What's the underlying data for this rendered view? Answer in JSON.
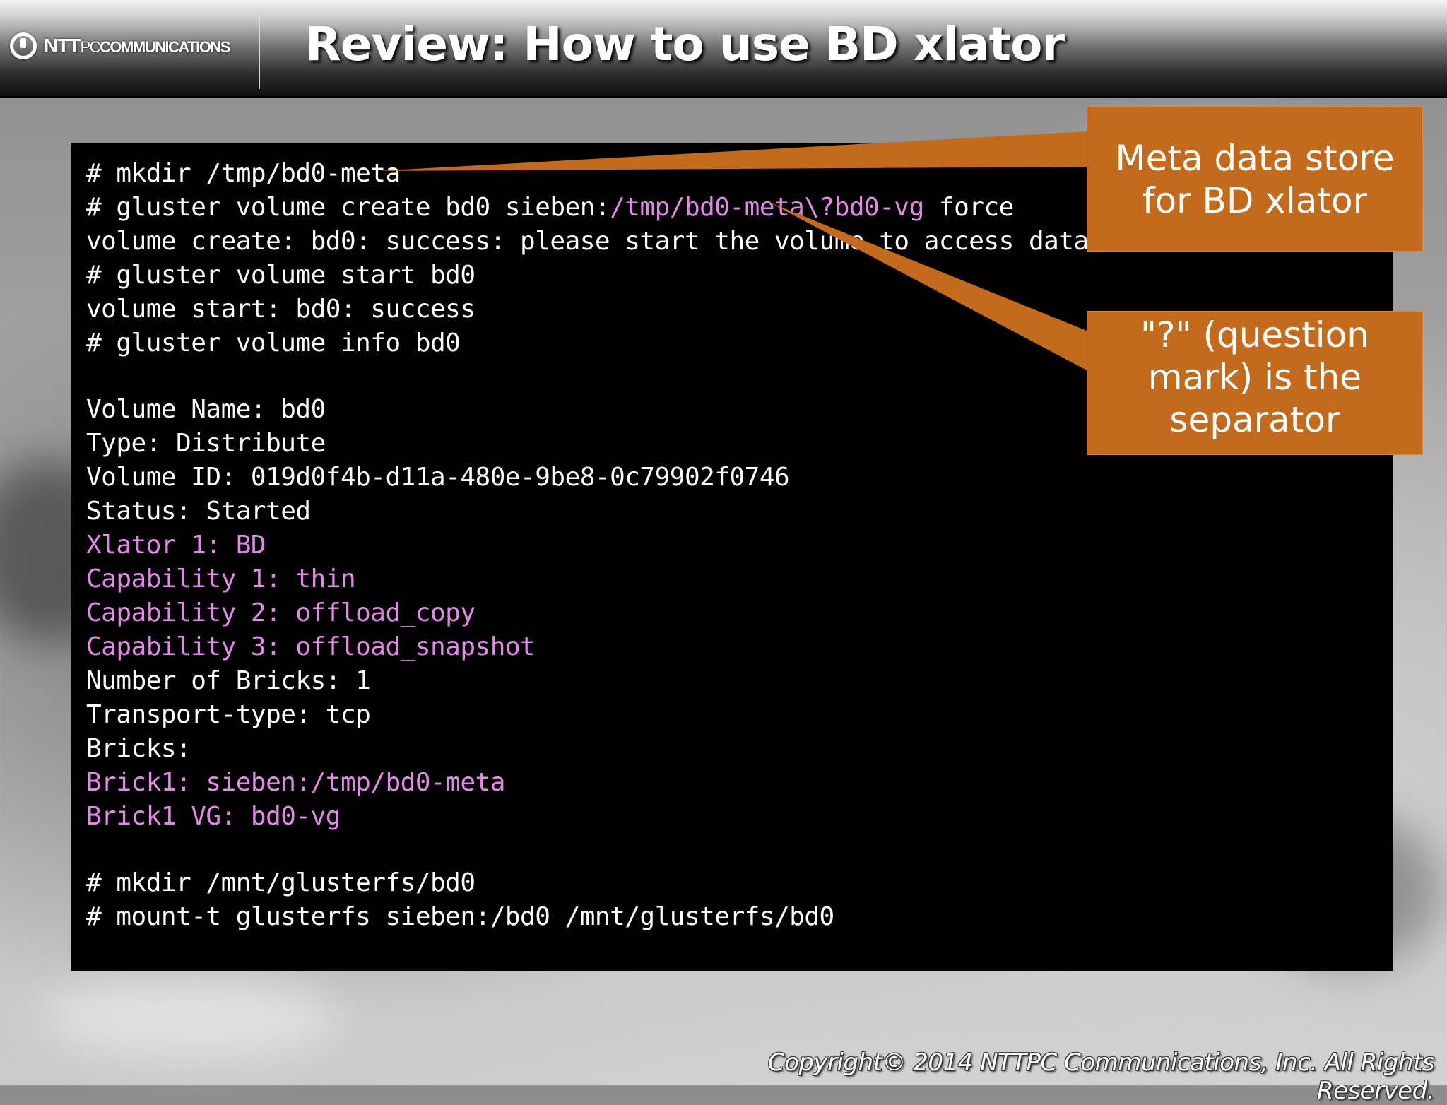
{
  "header": {
    "logo_main": "NTT",
    "logo_sub": "PC",
    "logo_tail": "COMMUNICATIONS",
    "title": "Review: How to use BD xlator"
  },
  "terminal": {
    "lines": [
      {
        "text": "# mkdir /tmp/bd0-meta"
      },
      {
        "pre": "# gluster volume create bd0 sieben:",
        "hl": "/tmp/bd0-meta\\?bd0-vg",
        "post": " force"
      },
      {
        "text": "volume create: bd0: success: please start the volume to access data"
      },
      {
        "text": "# gluster volume start bd0"
      },
      {
        "text": "volume start: bd0: success"
      },
      {
        "text": "# gluster volume info bd0"
      },
      {
        "text": "Volume Name: bd0"
      },
      {
        "text": "Type: Distribute"
      },
      {
        "text": "Volume ID: 019d0f4b-d11a-480e-9be8-0c79902f0746"
      },
      {
        "text": "Status: Started"
      },
      {
        "text": "Xlator 1: BD"
      },
      {
        "text": "Capability 1: thin"
      },
      {
        "text": "Capability 2: offload_copy"
      },
      {
        "text": "Capability 3: offload_snapshot"
      },
      {
        "text": "Number of Bricks: 1"
      },
      {
        "text": "Transport-type: tcp"
      },
      {
        "text": "Bricks:"
      },
      {
        "text": "Brick1: sieben:/tmp/bd0-meta"
      },
      {
        "text": "Brick1 VG: bd0-vg"
      },
      {
        "text": "# mkdir /mnt/glusterfs/bd0"
      },
      {
        "text": "# mount-t glusterfs sieben:/bd0 /mnt/glusterfs/bd0"
      }
    ]
  },
  "callouts": {
    "meta": [
      "Meta data store",
      "for BD xlator"
    ],
    "separator": [
      "\"?\" (question",
      "mark) is the",
      "separator"
    ]
  },
  "footer": {
    "copyright": "Copyright© 2014 NTTPC Communications, Inc. All Rights Reserved."
  },
  "colors": {
    "terminal_bg": "#000000",
    "terminal_text": "#ffffff",
    "highlight_text": "#e38ae8",
    "callout": "#c46a1d"
  }
}
